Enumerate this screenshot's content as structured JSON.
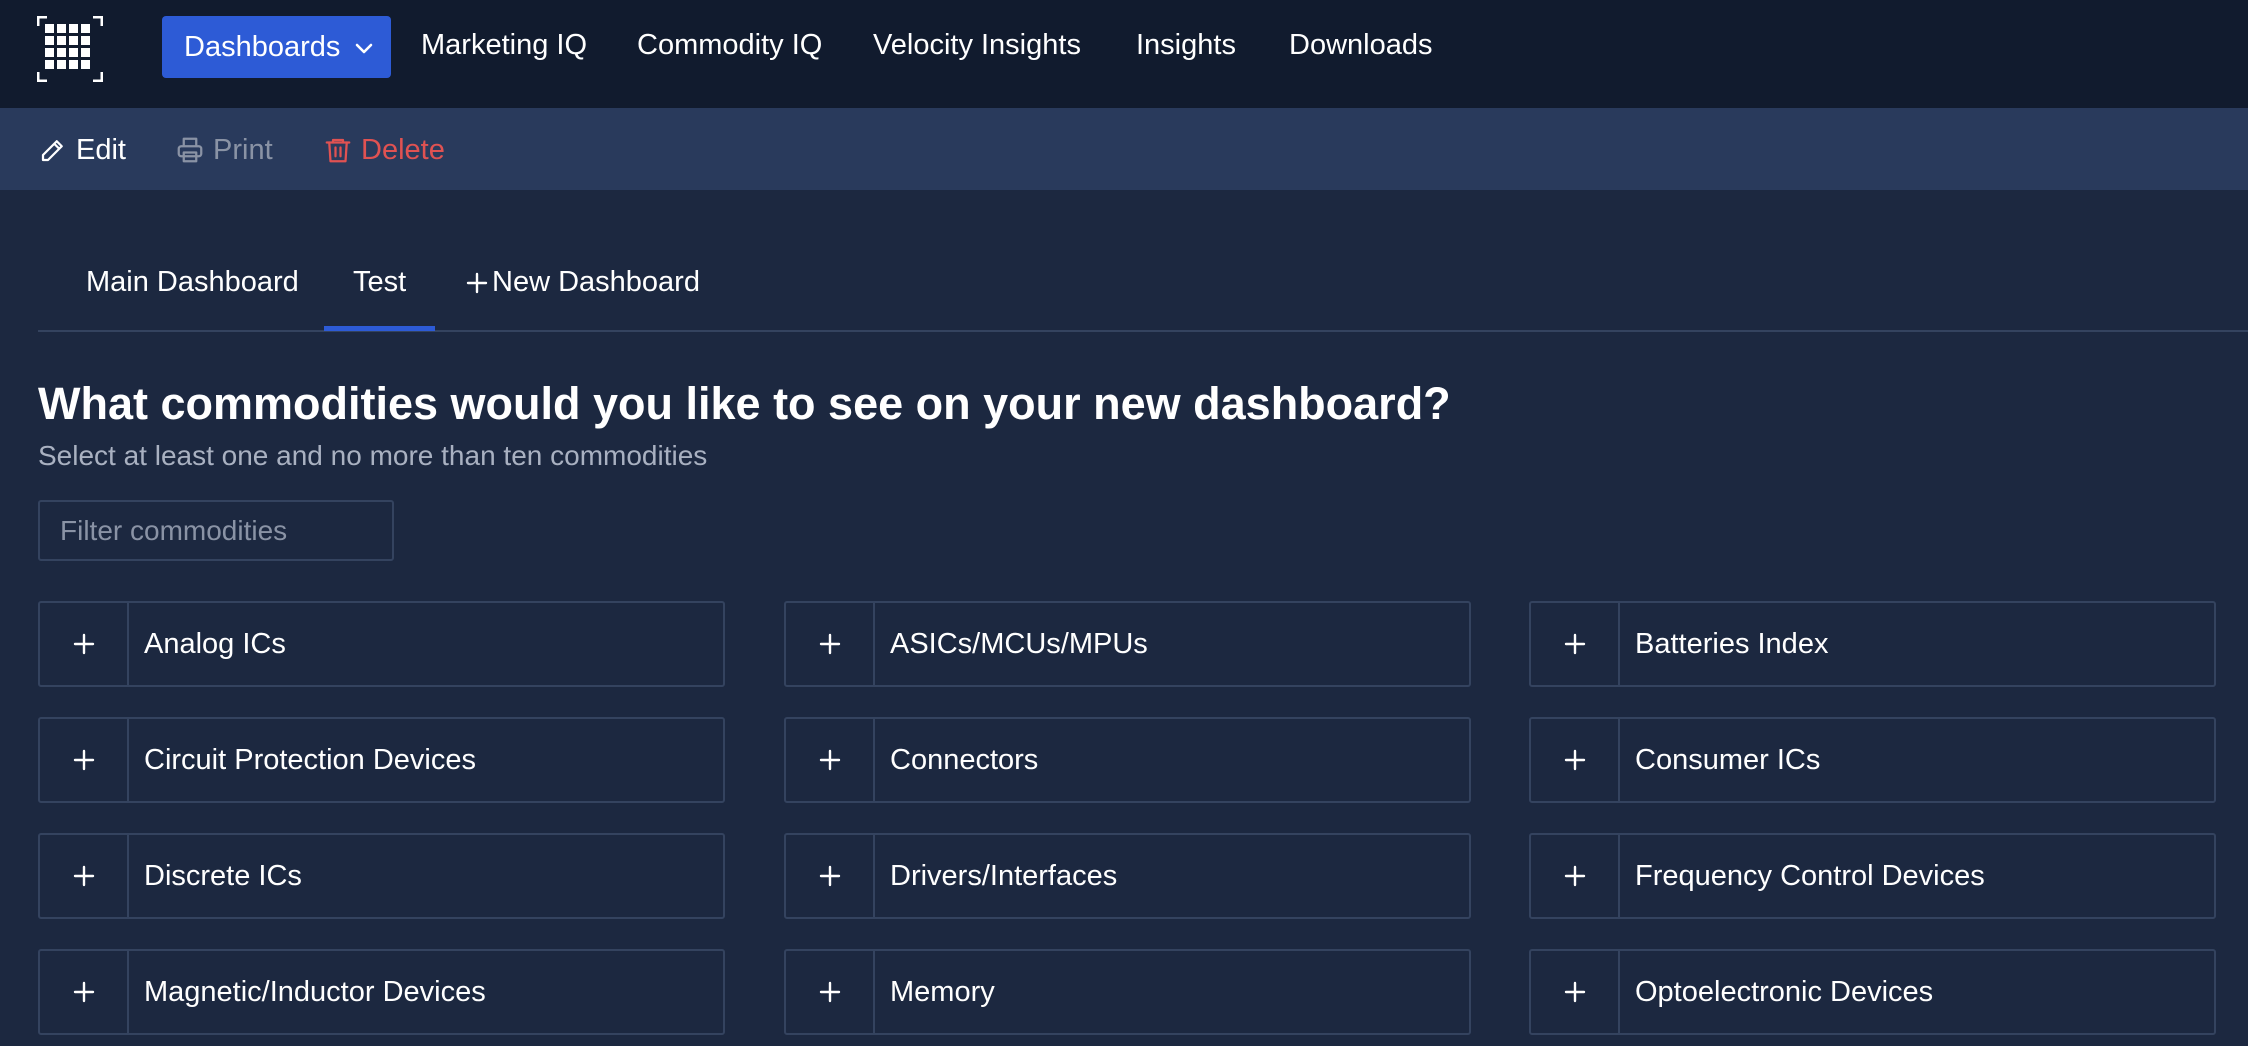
{
  "nav": {
    "logo_icon": "grid-logo-icon",
    "dashboards_label": "Dashboards",
    "links": [
      "Marketing IQ",
      "Commodity IQ",
      "Velocity Insights",
      "Insights",
      "Downloads"
    ]
  },
  "toolbar": {
    "edit_label": "Edit",
    "print_label": "Print",
    "delete_label": "Delete"
  },
  "tabs": {
    "items": [
      "Main Dashboard",
      "Test",
      "New Dashboard"
    ],
    "active": "Test"
  },
  "page": {
    "title": "What commodities would you like to see on your new dashboard?",
    "subtitle": "Select at least one and no more than ten commodities"
  },
  "filter": {
    "placeholder": "Filter commodities",
    "value": ""
  },
  "commodities": [
    "Analog ICs",
    "ASICs/MCUs/MPUs",
    "Batteries Index",
    "Circuit Protection Devices",
    "Connectors",
    "Consumer ICs",
    "Discrete ICs",
    "Drivers/Interfaces",
    "Frequency Control Devices",
    "Magnetic/Inductor Devices",
    "Memory",
    "Optoelectronic Devices"
  ],
  "colors": {
    "background": "#1c2840",
    "topnav": "#111b2e",
    "toolbar": "#293a5c",
    "accent": "#2d5bd6",
    "delete": "#e05252",
    "muted": "#8a93a5"
  }
}
